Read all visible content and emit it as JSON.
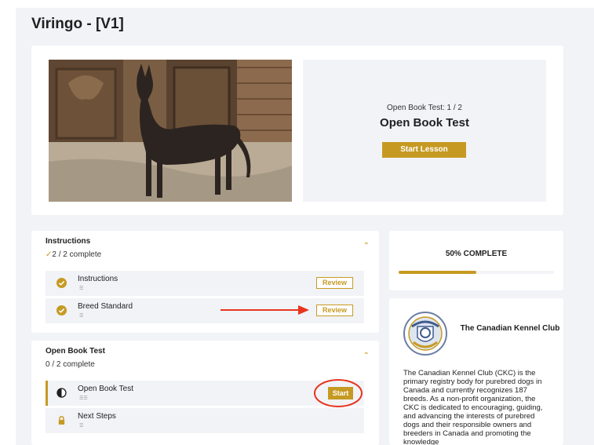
{
  "course": {
    "title": "Viringo - [V1]"
  },
  "hero": {
    "subtitle": "Open Book Test: 1 / 2",
    "heading": "Open Book Test",
    "button_label": "Start Lesson"
  },
  "sections": [
    {
      "title": "Instructions",
      "check": "✓",
      "progress": "2 / 2 complete",
      "lessons": [
        {
          "name": "Instructions",
          "type": "☰",
          "button": "Review"
        },
        {
          "name": "Breed Standard",
          "type": "☰",
          "button": "Review"
        }
      ]
    },
    {
      "title": "Open Book Test",
      "progress": "0 / 2 complete",
      "lessons": [
        {
          "name": "Open Book Test",
          "type": "☰☰",
          "button": "Start"
        },
        {
          "name": "Next Steps",
          "type": "☰"
        }
      ]
    }
  ],
  "progress": {
    "label": "50% COMPLETE",
    "fraction": 0.5
  },
  "club": {
    "name": "The Canadian Kennel Club",
    "description": "The Canadian Kennel Club (CKC) is the primary registry body for purebred dogs in Canada and currently recognizes 187 breeds. As a non-profit organization, the CKC is dedicated to encouraging, guiding, and advancing the interests of purebred dogs and their responsible owners and breeders in Canada and promoting the knowledge"
  },
  "colors": {
    "accent": "#c69a22",
    "annotation": "#e8341c",
    "panel": "#f2f3f7"
  }
}
